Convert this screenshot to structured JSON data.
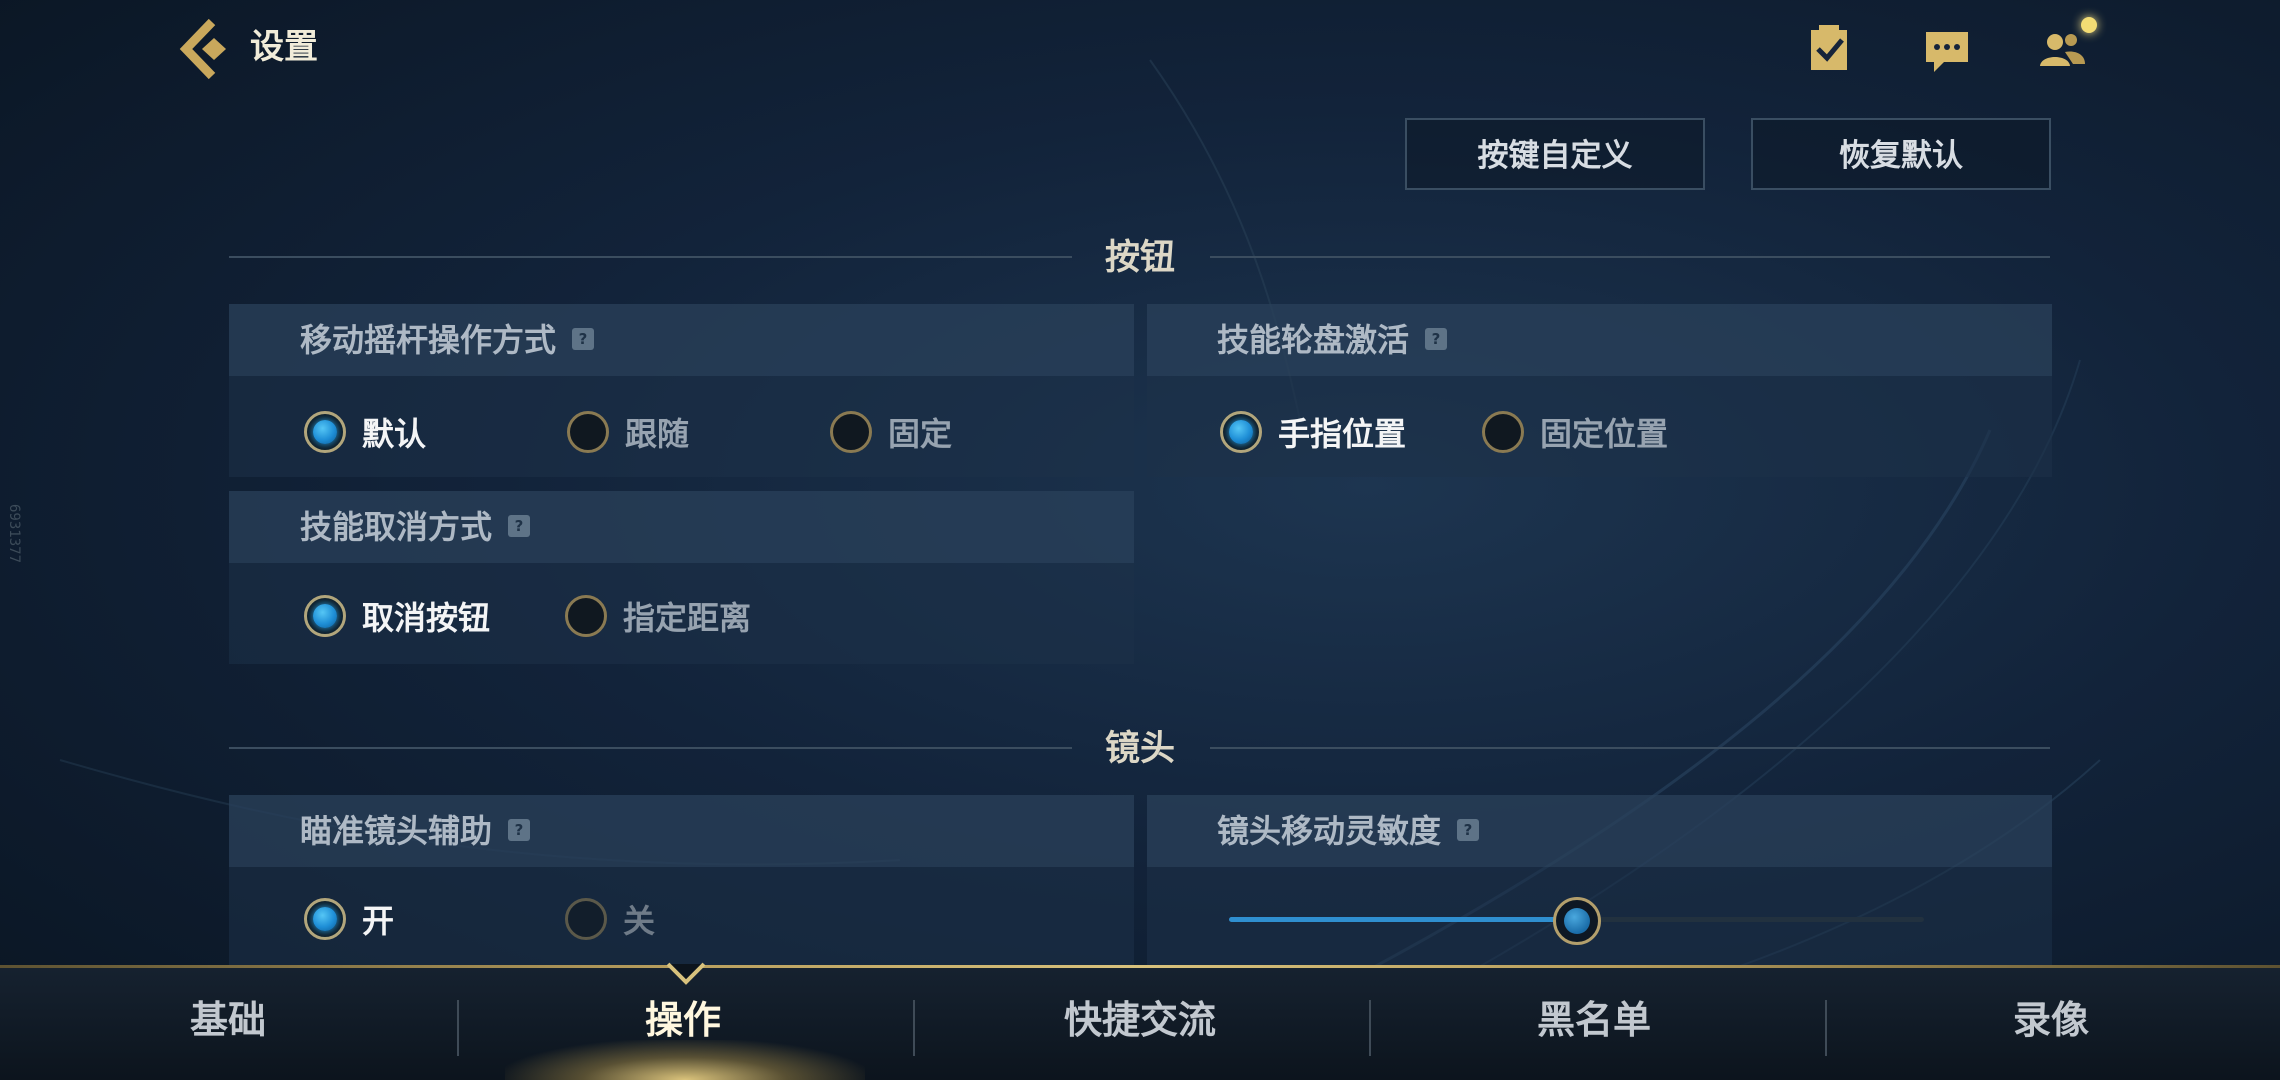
{
  "header": {
    "title": "设置",
    "icons": [
      "back-arrow-icon",
      "task-checklist-icon",
      "chat-icon",
      "friends-icon"
    ]
  },
  "actions": {
    "customize_keys": "按键自定义",
    "restore_default": "恢复默认"
  },
  "sections": {
    "buttons_title": "按钮",
    "camera_title": "镜头"
  },
  "panels": {
    "joystick": {
      "label": "移动摇杆操作方式",
      "options": [
        "默认",
        "跟随",
        "固定"
      ],
      "selected": "默认"
    },
    "skill_wheel": {
      "label": "技能轮盘激活",
      "options": [
        "手指位置",
        "固定位置"
      ],
      "selected": "手指位置"
    },
    "skill_cancel": {
      "label": "技能取消方式",
      "options": [
        "取消按钮",
        "指定距离"
      ],
      "selected": "取消按钮"
    },
    "aim_assist": {
      "label": "瞄准镜头辅助",
      "options": [
        "开",
        "关"
      ],
      "selected": "开"
    },
    "camera_sensitivity": {
      "label": "镜头移动灵敏度",
      "value_fraction": 0.5
    }
  },
  "help_glyph": "?",
  "bottom_nav": {
    "tabs": [
      "基础",
      "操作",
      "快捷交流",
      "黑名单",
      "录像"
    ],
    "active": "操作"
  },
  "side_watermark": "6931377",
  "colors": {
    "accent_gold": "#d8c27d",
    "radio_blue": "#1e8ed6",
    "notification_dot": "#f3dc74"
  }
}
